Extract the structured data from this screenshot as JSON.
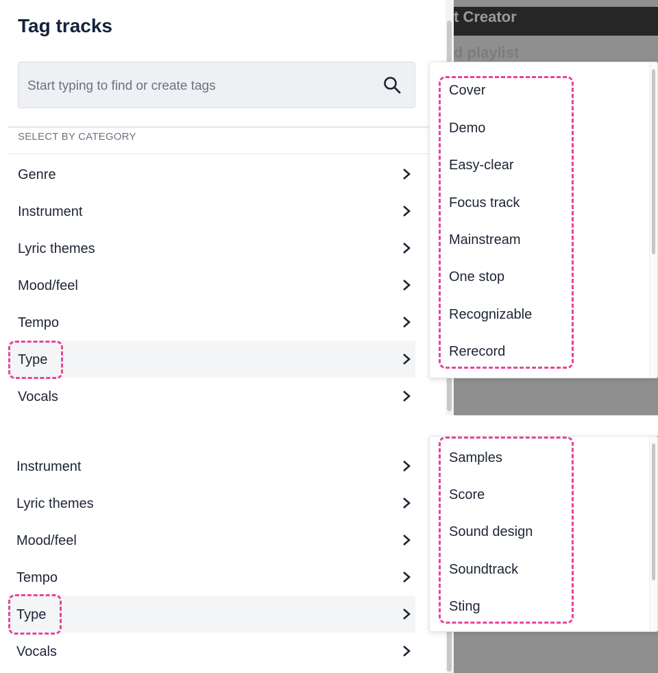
{
  "background_window": {
    "title_fragment": "t Creator",
    "subtitle_fragment": "d playlist"
  },
  "panel": {
    "title": "Tag tracks",
    "search": {
      "placeholder": "Start typing to find or create tags"
    },
    "section_label": "SELECT BY CATEGORY"
  },
  "top_categories": [
    {
      "label": "Genre"
    },
    {
      "label": "Instrument"
    },
    {
      "label": "Lyric themes"
    },
    {
      "label": "Mood/feel"
    },
    {
      "label": "Tempo"
    },
    {
      "label": "Type",
      "selected": true
    },
    {
      "label": "Vocals"
    }
  ],
  "top_dropdown": [
    "Cover",
    "Demo",
    "Easy-clear",
    "Focus track",
    "Mainstream",
    "One stop",
    "Recognizable",
    "Rerecord"
  ],
  "bottom_categories": [
    {
      "label": "Instrument"
    },
    {
      "label": "Lyric themes"
    },
    {
      "label": "Mood/feel"
    },
    {
      "label": "Tempo"
    },
    {
      "label": "Type",
      "selected": true
    },
    {
      "label": "Vocals"
    }
  ],
  "bottom_dropdown": [
    "Samples",
    "Score",
    "Sound design",
    "Soundtrack",
    "Sting"
  ],
  "colors": {
    "highlight": "#e6449a",
    "selected_row": "#f4f5f7",
    "title": "#14233b"
  },
  "icons": {
    "search": "search-icon",
    "chevron": "chevron-right-icon"
  }
}
